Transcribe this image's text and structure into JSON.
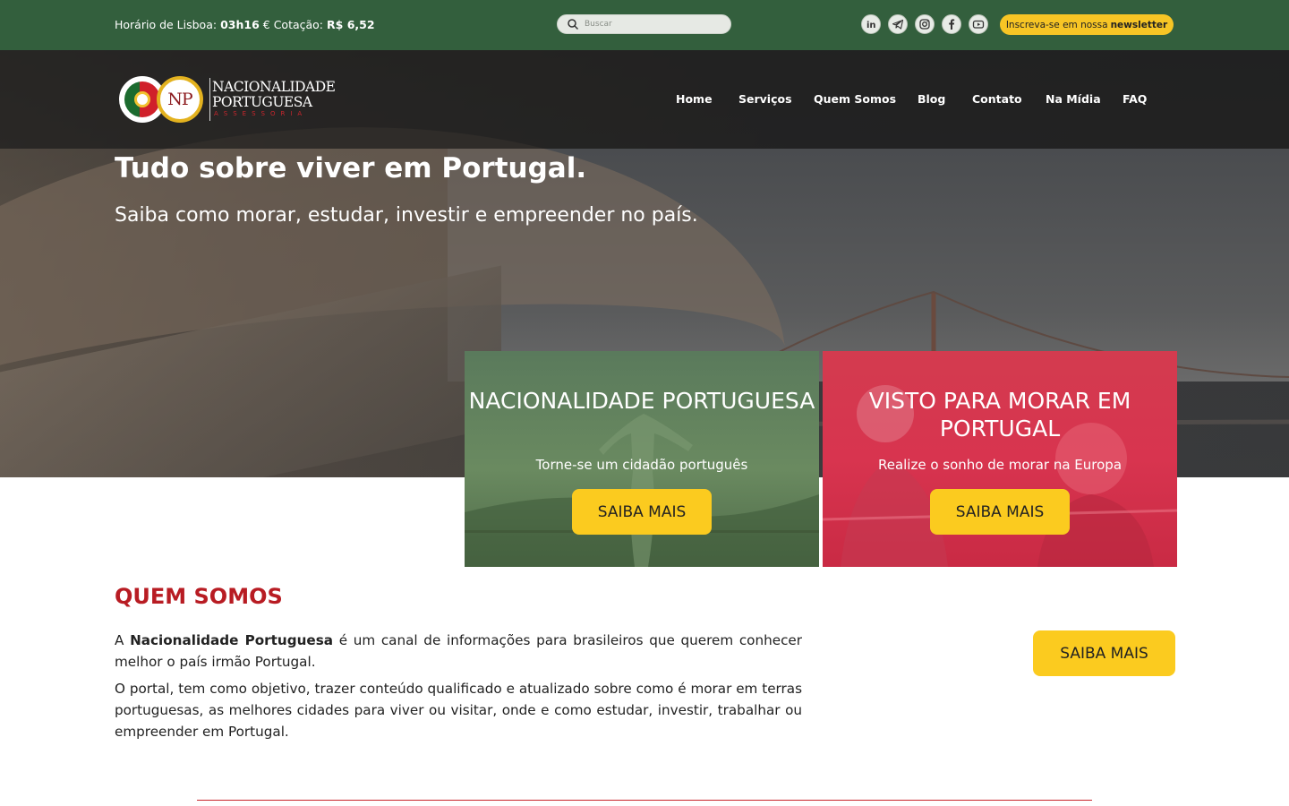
{
  "topbar": {
    "clock_label": "Horário de Lisboa:",
    "clock_time": "03h16",
    "rate_label": "€ Cotação:",
    "rate_value": "R$ 6,52",
    "search_placeholder": "Buscar",
    "social_icons": [
      "linkedin-icon",
      "telegram-icon",
      "instagram-icon",
      "facebook-icon",
      "youtube-icon"
    ],
    "newsletter_text": "Inscreva-se em nossa",
    "newsletter_bold": "newsletter"
  },
  "logo": {
    "monogram": "NP",
    "line1": "NACIONALIDADE",
    "line2": "PORTUGUESA",
    "line3": "ASSESSORIA"
  },
  "nav": {
    "items": [
      "Home",
      "Serviços",
      "Quem Somos",
      "Blog",
      "Contato",
      "Na Mídia",
      "FAQ"
    ]
  },
  "hero": {
    "title": "Tudo sobre viver em Portugal.",
    "subtitle": "Saiba como morar, estudar, investir e empreender no país."
  },
  "cards": [
    {
      "title": "NACIONALIDADE PORTUGUESA",
      "subtitle": "Torne-se um cidadão português",
      "button": "SAIBA MAIS"
    },
    {
      "title": "VISTO PARA MORAR EM PORTUGAL",
      "subtitle": "Realize o sonho de morar na Europa",
      "button": "SAIBA MAIS"
    }
  ],
  "about": {
    "title": "QUEM SOMOS",
    "p1_prefix": "A",
    "p1_bold": "Nacionalidade Portuguesa",
    "p1_rest": "é um canal de informações para brasileiros que querem conhecer melhor o país irmão Portugal.",
    "p2": "O portal, tem como objetivo, trazer conteúdo qualificado e atualizado sobre como é morar em terras portuguesas, as melhores cidades para viver ou visitar, onde e como estudar, investir, trabalhar ou empreender em Portugal.",
    "button": "SAIBA MAIS"
  },
  "colors": {
    "topbar_green": "#335f3d",
    "accent_yellow": "#fbcb1f",
    "brand_red": "#b81c23",
    "card_green": "#5a7a5c",
    "card_red": "#d33b4f"
  }
}
